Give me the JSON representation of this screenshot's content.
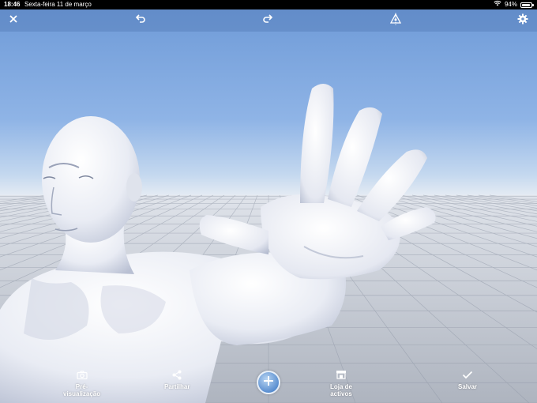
{
  "status_bar": {
    "time": "18:46",
    "date": "Sexta-feira 11 de março",
    "battery_text": "94%",
    "battery_level": 0.94,
    "wifi_icon": "wifi-icon"
  },
  "top_toolbar": {
    "close_icon": "close-icon",
    "undo_icon": "undo-icon",
    "redo_icon": "redo-icon",
    "symmetry_icon": "mirror-symmetry-icon",
    "settings_icon": "gear-icon"
  },
  "bottom_toolbar": {
    "preview": {
      "label_line1": "Pré-",
      "label_line2": "visualização",
      "icon": "camera-icon"
    },
    "share": {
      "label": "Partilhar",
      "icon": "share-icon"
    },
    "add": {
      "icon": "plus-icon"
    },
    "asset_store": {
      "label_line1": "Loja de",
      "label_line2": "activos",
      "icon": "store-icon"
    },
    "save": {
      "label": "Salvar",
      "icon": "checkmark-icon"
    }
  },
  "colors": {
    "toolbar_bg": "#5a82be",
    "sky_top": "#6f9bd8",
    "floor": "#b9bec7",
    "model": "#eef0f6"
  }
}
